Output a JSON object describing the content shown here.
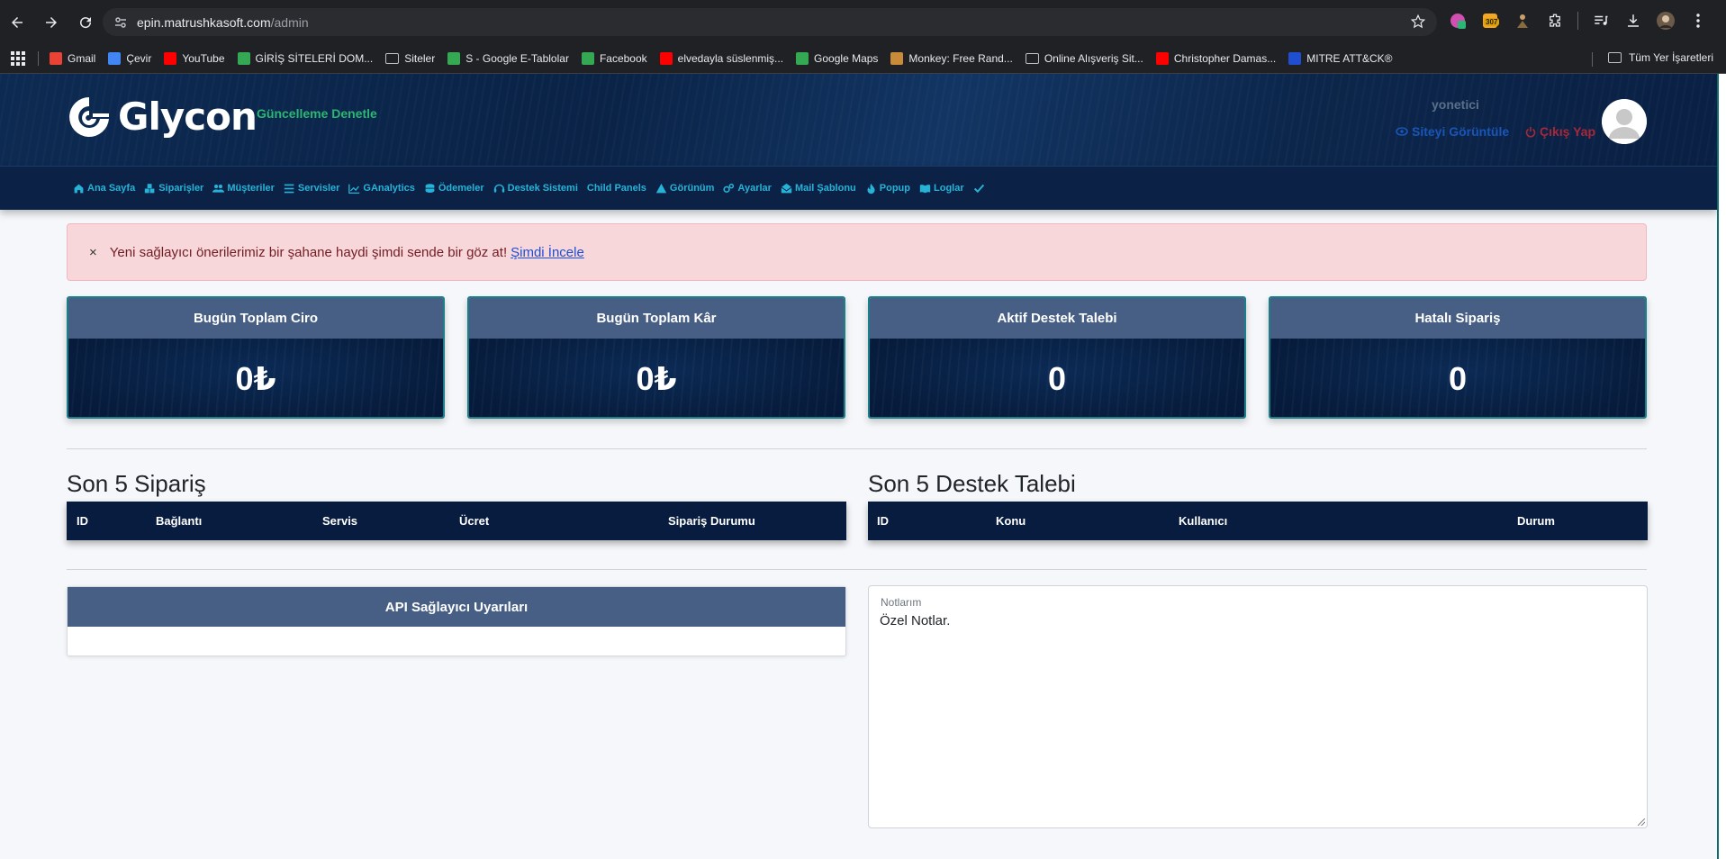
{
  "browser": {
    "url_host": "epin.matrushkasoft.com",
    "url_path": "/admin",
    "extension_badge": "307",
    "bookmarks": [
      {
        "label": "Gmail",
        "color": "#ea4335"
      },
      {
        "label": "Çevir",
        "color": "#4285f4"
      },
      {
        "label": "YouTube",
        "color": "#ff0000"
      },
      {
        "label": "GİRİŞ SİTELERİ DOM...",
        "color": "#34a853"
      },
      {
        "label": "Siteler",
        "color": "folder"
      },
      {
        "label": "S - Google E-Tablolar",
        "color": "#34a853"
      },
      {
        "label": "Facebook",
        "color": "#34a853"
      },
      {
        "label": "elvedayla süslenmiş...",
        "color": "#ff0000"
      },
      {
        "label": "Google Maps",
        "color": "#34a853"
      },
      {
        "label": "Monkey: Free Rand...",
        "color": "#c98a3a"
      },
      {
        "label": "Online Alışveriş Sit...",
        "color": "folder"
      },
      {
        "label": "Christopher Damas...",
        "color": "#ff0000"
      },
      {
        "label": "MITRE ATT&CK®",
        "color": "#1f4fd0"
      }
    ],
    "all_bookmarks": "Tüm Yer İşaretleri"
  },
  "header": {
    "logo_text": "Glycon",
    "update_link": "Güncelleme Denetle",
    "user_name": "yonetici",
    "view_site": "Siteyi Görüntüle",
    "logout": "Çıkış Yap"
  },
  "menu": [
    {
      "label": "Ana Sayfa",
      "icon": "home-icon"
    },
    {
      "label": "Siparişler",
      "icon": "boxes-icon"
    },
    {
      "label": "Müşteriler",
      "icon": "users-icon"
    },
    {
      "label": "Servisler",
      "icon": "list-icon"
    },
    {
      "label": "GAnalytics",
      "icon": "chart-line-icon"
    },
    {
      "label": "Ödemeler",
      "icon": "coins-icon"
    },
    {
      "label": "Destek Sistemi",
      "icon": "headset-icon"
    },
    {
      "label": "Child Panels",
      "icon": ""
    },
    {
      "label": "Görünüm",
      "icon": "pyramid-icon"
    },
    {
      "label": "Ayarlar",
      "icon": "gears-icon"
    },
    {
      "label": "Mail Şablonu",
      "icon": "mail-icon"
    },
    {
      "label": "Popup",
      "icon": "fire-icon"
    },
    {
      "label": "Loglar",
      "icon": "book-icon"
    }
  ],
  "alert": {
    "close": "×",
    "text": "Yeni sağlayıcı önerilerimiz bir şahane haydi şimdi sende bir göz at!",
    "link": "Şimdi İncele"
  },
  "stats": [
    {
      "title": "Bugün Toplam Ciro",
      "value": "0₺"
    },
    {
      "title": "Bugün Toplam Kâr",
      "value": "0₺"
    },
    {
      "title": "Aktif Destek Talebi",
      "value": "0"
    },
    {
      "title": "Hatalı Sipariş",
      "value": "0"
    }
  ],
  "orders": {
    "title": "Son 5 Sipariş",
    "columns": [
      "ID",
      "Bağlantı",
      "Servis",
      "Ücret",
      "Sipariş Durumu"
    ]
  },
  "tickets": {
    "title": "Son 5 Destek Talebi",
    "columns": [
      "ID",
      "Konu",
      "Kullanıcı",
      "Durum"
    ]
  },
  "api_panel": {
    "title": "API Sağlayıcı Uyarıları"
  },
  "notes": {
    "label": "Notlarım",
    "text": "Özel Notlar."
  }
}
